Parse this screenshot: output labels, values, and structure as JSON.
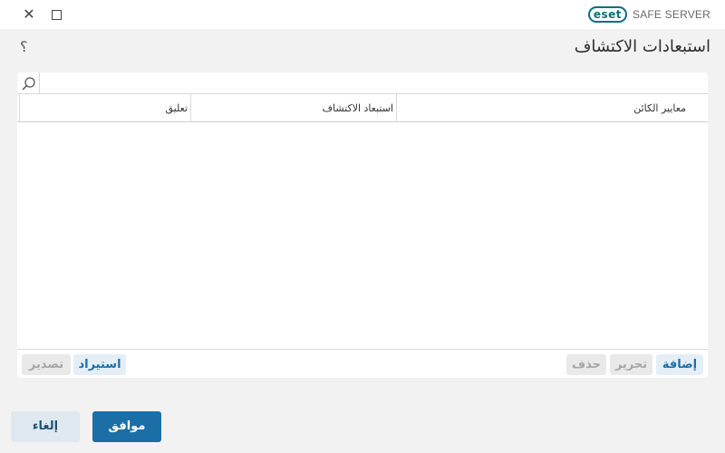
{
  "window": {
    "close_glyph": "✕",
    "brand_logo": "eset",
    "brand_name": "SAFE SERVER"
  },
  "header": {
    "help_glyph": "؟",
    "title": "استبعادات الاكتشاف"
  },
  "search": {
    "placeholder": ""
  },
  "table": {
    "columns": [
      "تعليق",
      "استبعاد الاكتشاف",
      "معايير الكائن"
    ],
    "rows": []
  },
  "toolbar": {
    "export_label": "تصدير",
    "import_label": "استيراد",
    "delete_label": "حذف",
    "edit_label": "تحرير",
    "add_label": "إضافة"
  },
  "footer": {
    "ok_label": "موافق",
    "cancel_label": "إلغاء"
  },
  "colors": {
    "accent": "#1b6fa6",
    "brand": "#0c6f7a",
    "background": "#f2f2f3"
  },
  "icons": [
    "close-icon",
    "maximize-icon",
    "help-icon",
    "search-icon"
  ]
}
